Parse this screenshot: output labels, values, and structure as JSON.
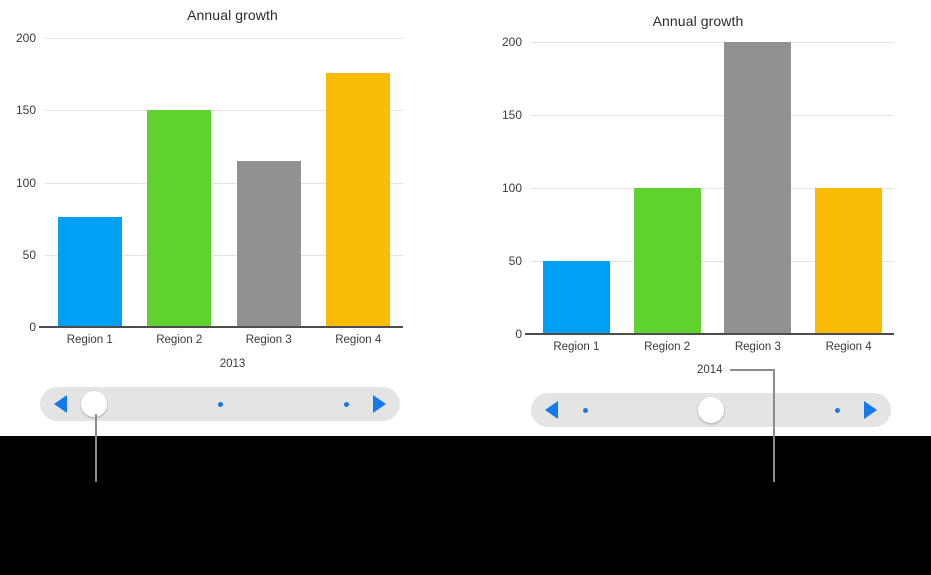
{
  "theme": {
    "background": "#000000",
    "canvas": "#ffffff",
    "accent_blue": "#1479ec",
    "gridline": "#e3e3e3",
    "axis": "#4d4d4d",
    "slider_track": "#e4e4e4",
    "leader_line": "#8c8c8c"
  },
  "series_colors": {
    "region_1": "#00a0f5",
    "region_2": "#5fd22f",
    "region_3": "#919191",
    "region_4": "#fabb05"
  },
  "panels": [
    {
      "id": "panel-2013",
      "title": "Annual growth",
      "year_caption": "2013",
      "slider": {
        "prev_icon": "triangle-left-icon",
        "next_icon": "triangle-right-icon",
        "knob_position_pct": 15,
        "tick_dots_pct": [
          50,
          85
        ]
      }
    },
    {
      "id": "panel-2014",
      "title": "Annual growth",
      "year_caption": "2014",
      "slider": {
        "prev_icon": "triangle-left-icon",
        "next_icon": "triangle-right-icon",
        "knob_position_pct": 50,
        "tick_dots_pct": [
          15,
          85
        ]
      }
    }
  ],
  "chart_data": [
    {
      "type": "bar",
      "title": "Annual growth",
      "xlabel": "2013",
      "ylabel": "",
      "categories": [
        "Region 1",
        "Region 2",
        "Region 3",
        "Region 4"
      ],
      "values": [
        76,
        150,
        115,
        176
      ],
      "colors": [
        "#00a0f5",
        "#5fd22f",
        "#919191",
        "#fabb05"
      ],
      "ylim": [
        0,
        200
      ],
      "yticks": [
        0,
        50,
        100,
        150,
        200
      ],
      "ytick_labels": [
        "0",
        "50",
        "100",
        "150",
        "200"
      ],
      "grid": true,
      "legend": "none"
    },
    {
      "type": "bar",
      "title": "Annual growth",
      "xlabel": "2014",
      "ylabel": "",
      "categories": [
        "Region 1",
        "Region 2",
        "Region 3",
        "Region 4"
      ],
      "values": [
        50,
        100,
        200,
        100
      ],
      "colors": [
        "#00a0f5",
        "#5fd22f",
        "#919191",
        "#fabb05"
      ],
      "ylim": [
        0,
        200
      ],
      "yticks": [
        0,
        50,
        100,
        150,
        200
      ],
      "ytick_labels": [
        "0",
        "50",
        "100",
        "150",
        "200"
      ],
      "grid": true,
      "legend": "none"
    }
  ]
}
